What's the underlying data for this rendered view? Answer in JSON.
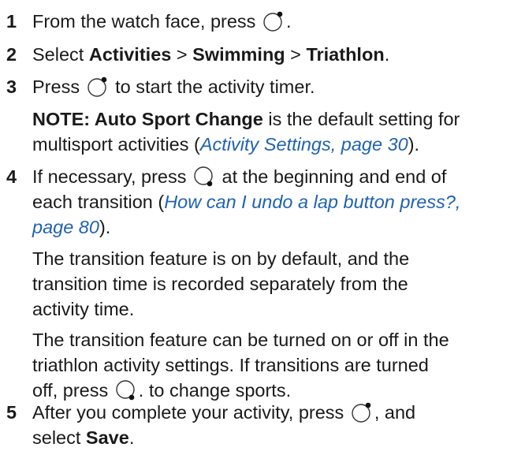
{
  "step1": {
    "num": "1",
    "text_a": "From the watch face, press",
    "text_b": "."
  },
  "step2": {
    "num": "2",
    "text_a": "Select ",
    "activities": "Activities",
    "sep1": " > ",
    "swimming": "Swimming",
    "sep2": " > ",
    "triathlon": "Triathlon",
    "text_b": "."
  },
  "step3": {
    "num": "3",
    "text_a": "Press",
    "text_b": "to start the activity timer."
  },
  "note": {
    "line1_bold": "NOTE: Auto Sport Change",
    "line1_rest": " is the default setting for",
    "line2_a": "multisport activities (",
    "line2_link": "Activity Settings, page 30",
    "line2_b": ")."
  },
  "step4": {
    "num": "4",
    "line1_a": "If necessary, press",
    "line1_b": "at the beginning and end of",
    "line2_a": "each transition (",
    "line2_link": "How can I undo a lap button press?,",
    "line3_link": "page 80",
    "line3_b": ")."
  },
  "para1": {
    "line1": "The transition feature is on by default, and the",
    "line2": "transition time is recorded separately from the",
    "line3": "activity time."
  },
  "para2": {
    "line1": "The transition feature can be turned on or off in the",
    "line2": "triathlon activity settings. If transitions are turned",
    "line3_a": "off, press",
    "line3_b": ". to change sports."
  },
  "step5": {
    "num": "5",
    "line1_a": "After you complete your activity, press",
    "line1_b": ", and",
    "line2_a": "select ",
    "line2_bold": "Save",
    "line2_b": "."
  },
  "icons": {
    "start_button": "watch-start-stop-button-icon",
    "lap_button": "watch-lap-back-button-icon"
  }
}
